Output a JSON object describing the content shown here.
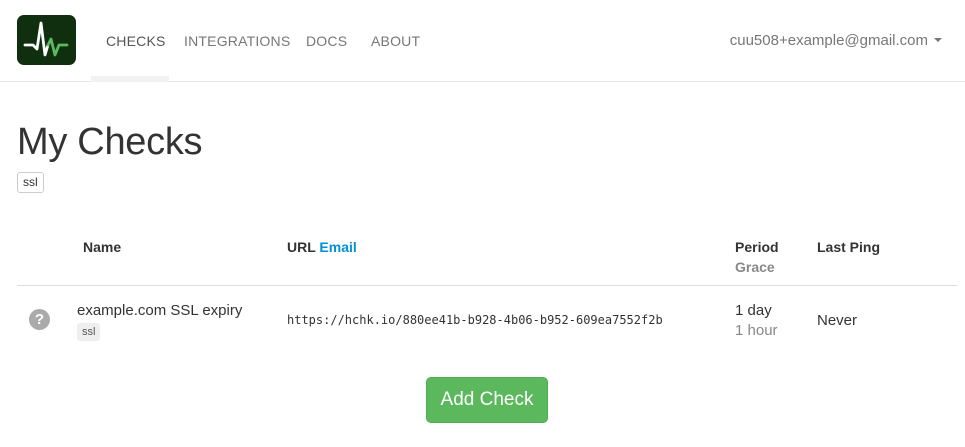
{
  "nav": {
    "items": [
      {
        "label": "CHECKS",
        "active": true
      },
      {
        "label": "INTEGRATIONS",
        "active": false
      },
      {
        "label": "DOCS",
        "active": false
      },
      {
        "label": "ABOUT",
        "active": false
      }
    ],
    "user_email": "cuu508+example@gmail.com",
    "logo_icon": "pulse-logo-icon"
  },
  "page": {
    "title": "My Checks",
    "tag_filters": [
      "ssl"
    ]
  },
  "table": {
    "headers": {
      "name": "Name",
      "url": "URL",
      "email": "Email",
      "period": "Period",
      "grace": "Grace",
      "last_ping": "Last Ping"
    },
    "rows": [
      {
        "status_icon": "question-circle-icon",
        "name": "example.com SSL expiry",
        "tag": "ssl",
        "url": "https://hchk.io/880ee41b-b928-4b06-b952-609ea7552f2b",
        "period": "1 day",
        "grace": "1 hour",
        "last_ping": "Never"
      }
    ]
  },
  "actions": {
    "add_check_label": "Add Check"
  },
  "colors": {
    "logo_bg": "#0f2f0f",
    "logo_stroke_white": "#ffffff",
    "logo_stroke_green": "#5cb85c",
    "accent_link": "#0091d6",
    "primary_button": "#5cb85c",
    "status_unknown": "#aaaaaa"
  }
}
